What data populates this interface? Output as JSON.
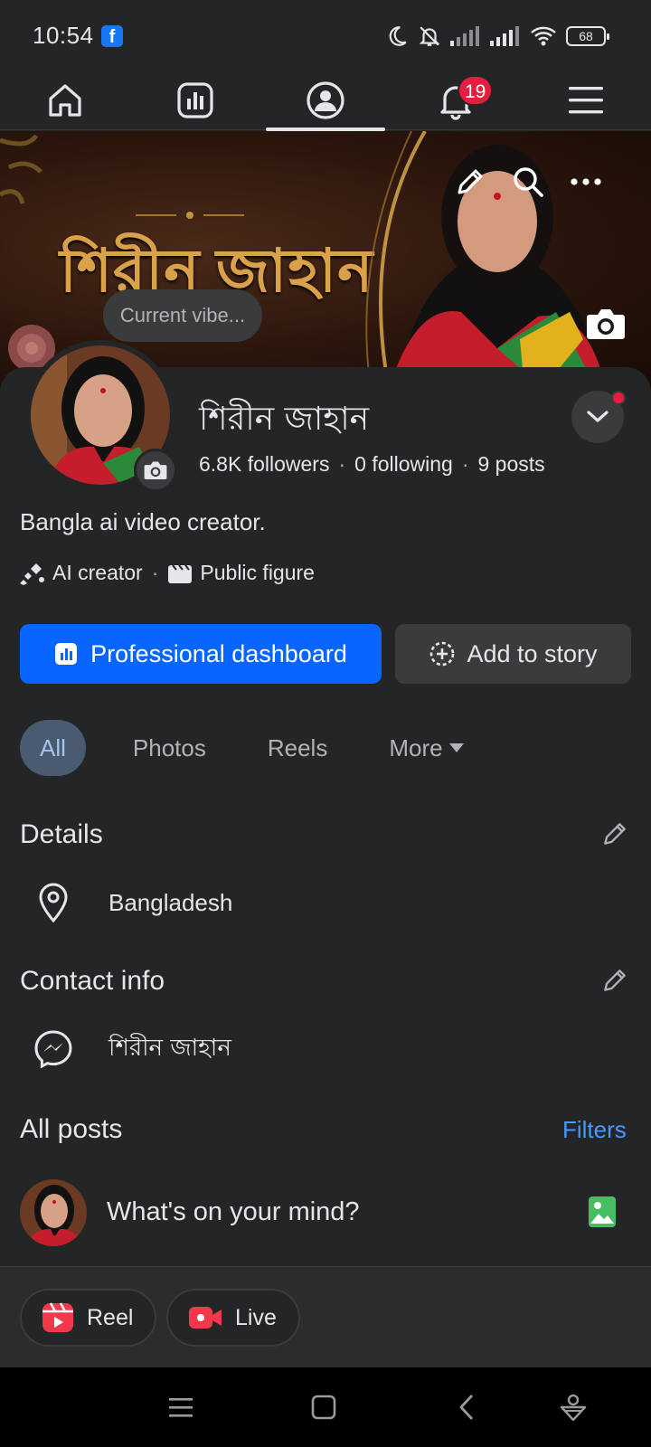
{
  "status_bar": {
    "time": "10:54",
    "app_badge": "f",
    "battery": "68"
  },
  "nav": {
    "items": [
      {
        "name": "home",
        "icon": "home-icon"
      },
      {
        "name": "dashboard",
        "icon": "bar-chart-icon"
      },
      {
        "name": "profile",
        "icon": "profile-icon",
        "active": true
      },
      {
        "name": "notifications",
        "icon": "bell-icon",
        "badge": "19"
      },
      {
        "name": "menu",
        "icon": "menu-icon"
      }
    ]
  },
  "cover": {
    "title_text": "শিরীন জাহান",
    "vibe_placeholder": "Current vibe..."
  },
  "profile": {
    "name": "শিরীন জাহান",
    "followers": "6.8K followers",
    "following": "0 following",
    "posts": "9 posts",
    "stats_separator": "·",
    "bio": "Bangla ai video creator.",
    "tags": [
      "AI creator",
      "Public figure"
    ],
    "tag_separator": "·"
  },
  "buttons": {
    "primary": "Professional dashboard",
    "secondary": "Add to story"
  },
  "tabs": [
    {
      "label": "All",
      "active": true
    },
    {
      "label": "Photos"
    },
    {
      "label": "Reels"
    },
    {
      "label": "More"
    }
  ],
  "details": {
    "title": "Details",
    "location": "Bangladesh"
  },
  "contact": {
    "title": "Contact info",
    "messenger": "শিরীন জাহান"
  },
  "posts": {
    "title": "All posts",
    "filters": "Filters",
    "composer_placeholder": "What's on your mind?"
  },
  "actions": {
    "reel": "Reel",
    "live": "Live"
  },
  "colors": {
    "background": "#242526",
    "primary_button": "#0866ff",
    "link": "#4599ff",
    "badge": "#e41e3f",
    "active_tab": "#4a5a70"
  }
}
